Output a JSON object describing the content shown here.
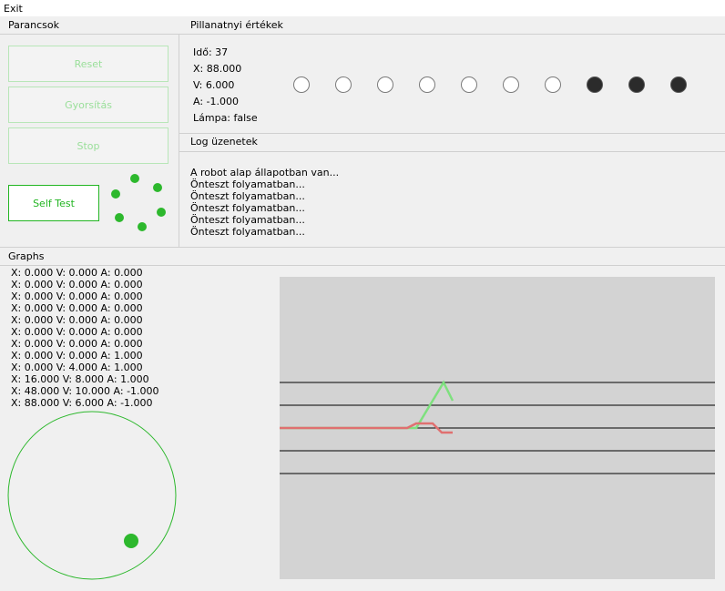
{
  "menu": {
    "exit": "Exit"
  },
  "commands": {
    "header": "Parancsok",
    "reset": "Reset",
    "accelerate": "Gyorsítás",
    "stop": "Stop",
    "self_test": "Self Test"
  },
  "current": {
    "header": "Pillanatnyi értékek",
    "time": "Idő: 37",
    "x": "X: 88.000",
    "v": "V: 6.000",
    "a": "A: -1.000",
    "lamp": "Lámpa: false",
    "lamps": [
      false,
      false,
      false,
      false,
      false,
      false,
      false,
      true,
      true,
      true
    ]
  },
  "log": {
    "header": "Log üzenetek",
    "lines": [
      "A robot alap állapotban van...",
      "Önteszt folyamatban...",
      "Önteszt folyamatban...",
      "Önteszt folyamatban...",
      "Önteszt folyamatban...",
      "Önteszt folyamatban..."
    ]
  },
  "graphs": {
    "header": "Graphs",
    "lines": [
      "X: 0.000 V: 0.000 A: 0.000",
      "X: 0.000 V: 0.000 A: 0.000",
      "X: 0.000 V: 0.000 A: 0.000",
      "X: 0.000 V: 0.000 A: 0.000",
      "X: 0.000 V: 0.000 A: 0.000",
      "X: 0.000 V: 0.000 A: 0.000",
      "X: 0.000 V: 0.000 A: 0.000",
      "X: 0.000 V: 0.000 A: 1.000",
      "X: 0.000 V: 4.000 A: 1.000",
      "X: 16.000 V: 8.000 A: 1.000",
      "X: 48.000 V: 10.000 A: -1.000",
      "X: 88.000 V: 6.000 A: -1.000"
    ]
  },
  "colors": {
    "accent": "#22b522",
    "v_series": "#7ee07e",
    "a_series": "#e07070",
    "lamp_on": "#2b2b2b"
  }
}
